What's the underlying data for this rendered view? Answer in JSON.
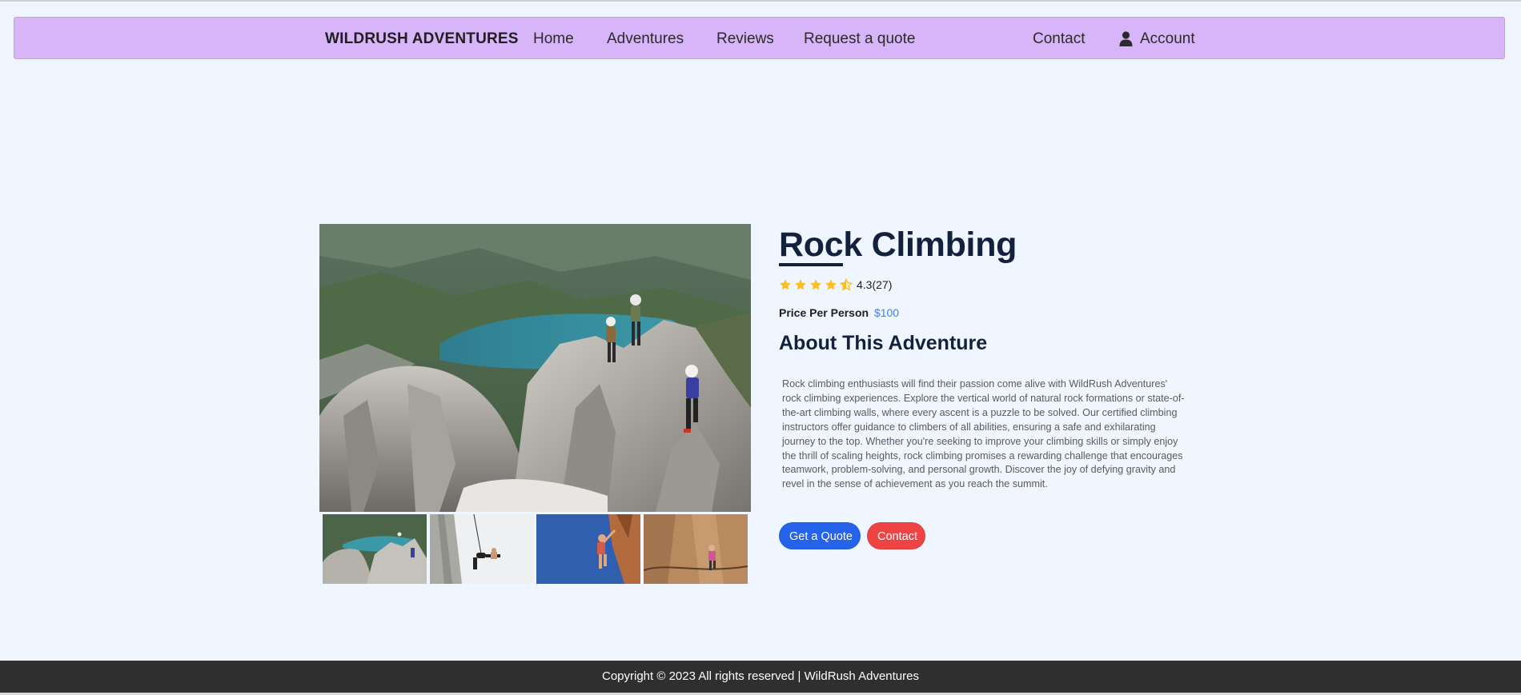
{
  "nav": {
    "brand": "WILDRUSH ADVENTURES",
    "home": "Home",
    "adventures": "Adventures",
    "reviews": "Reviews",
    "request_quote": "Request a quote",
    "contact": "Contact",
    "account": "Account",
    "bg_color": "#d8b4f8"
  },
  "adventure": {
    "title": "Rock Climbing",
    "rating_value": 4.3,
    "rating_text": "4.3(27)",
    "price_label": "Price Per Person",
    "price_value": "$100",
    "about_heading": "About This Adventure",
    "description": "Rock climbing enthusiasts will find their passion come alive with WildRush Adventures' rock climbing experiences. Explore the vertical world of natural rock formations or state-of-the-art climbing walls, where every ascent is a puzzle to be solved. Our certified climbing instructors offer guidance to climbers of all abilities, ensuring a safe and exhilarating journey to the top. Whether you're seeking to improve your climbing skills or simply enjoy the thrill of scaling heights, rock climbing promises a rewarding challenge that encourages teamwork, problem-solving, and personal growth. Discover the joy of defying gravity and revel in the sense of achievement as you reach the summit.",
    "buttons": {
      "quote": "Get a Quote",
      "contact": "Contact"
    }
  },
  "colors": {
    "page_bg": "#eff6ff",
    "star": "#fbbf24",
    "price": "#3b82f6",
    "quote_button": "#2563eb",
    "contact_button": "#ef4444",
    "footer_bg": "#2f2f2f"
  },
  "footer": {
    "text": "Copyright © 2023 All rights reserved | WildRush Adventures"
  }
}
